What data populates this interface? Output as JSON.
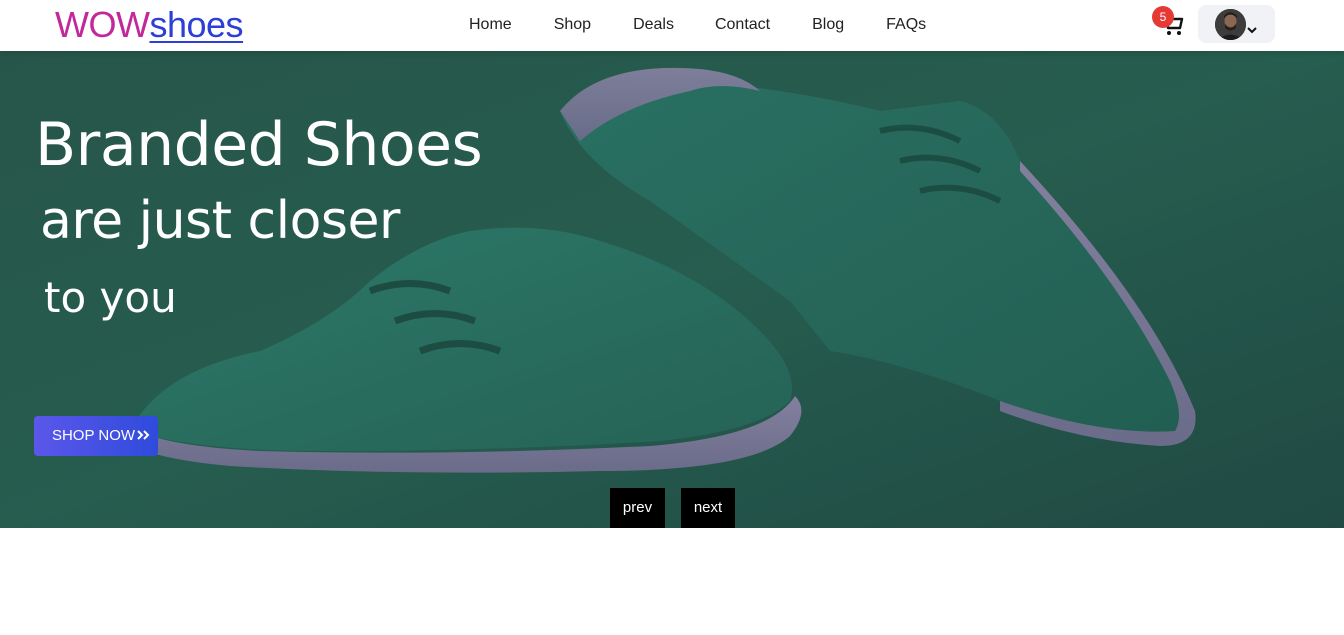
{
  "brand": {
    "part1": "WOW",
    "part2": "shoes"
  },
  "nav": {
    "items": [
      {
        "label": "Home"
      },
      {
        "label": "Shop"
      },
      {
        "label": "Deals"
      },
      {
        "label": "Contact"
      },
      {
        "label": "Blog"
      },
      {
        "label": "FAQs"
      }
    ]
  },
  "cart": {
    "count": "5",
    "icon": "cart-icon"
  },
  "profile": {
    "icon": "avatar",
    "menu_icon": "chevron-down-icon"
  },
  "hero": {
    "line1": "Branded Shoes",
    "line2": "are just closer",
    "line3": "to you",
    "cta_label": "SHOP NOW",
    "cta_icon": "double-chevron-right-icon",
    "prev_label": "prev",
    "next_label": "next"
  },
  "colors": {
    "brand_primary": "#c2289a",
    "brand_secondary": "#2c3fd6",
    "cta_start": "#5b57ea",
    "cta_end": "#2f4bdc",
    "badge": "#e53935",
    "hero_bg": "#2a5a4e"
  }
}
